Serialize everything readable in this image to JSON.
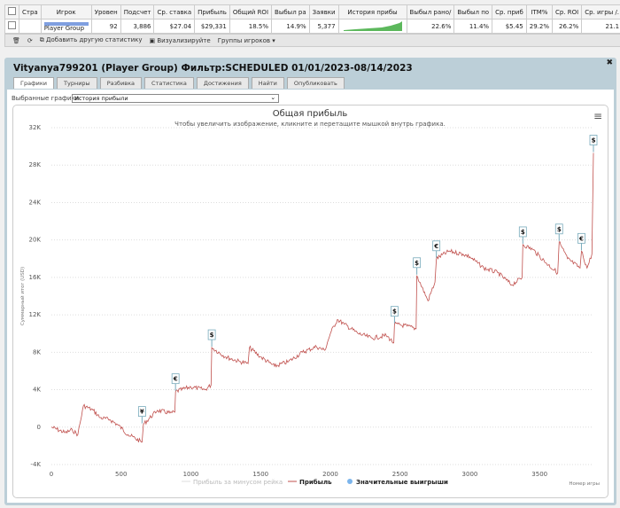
{
  "table": {
    "headers": [
      "Стра",
      "Игрок",
      "Уровен",
      "Подсчет",
      "Ср. ставка",
      "Прибыль",
      "Общий ROI",
      "Выбыл ра",
      "Заявки",
      "История прибы",
      "Выбыл рано/",
      "Выбыл по",
      "Ср. приб",
      "ITM%",
      "Ср. ROI",
      "Ср. игры /."
    ],
    "row": {
      "player": "Player Group",
      "level": "92",
      "count": "3,886",
      "avg_stake": "$27.04",
      "profit": "$29,331",
      "roi": "18.5%",
      "early": "14.9%",
      "entries": "5,377",
      "early2": "22.6%",
      "late": "11.4%",
      "avg_profit": "$5.45",
      "itm": "29.2%",
      "avg_roi": "26.2%",
      "avg_games": "21.1",
      "remove": "x"
    }
  },
  "toolbar": {
    "add_stat": "Добавить другую статистику",
    "visualize": "Визуализируйте",
    "groups": "Группы игроков ▾"
  },
  "panel": {
    "title": "Vityanya799201 (Player Group) Фильтр:SCHEDULED 01/01/2023-08/14/2023",
    "close": "✖",
    "tabs": [
      "Графики",
      "Турниры",
      "Разбивка",
      "Статистика",
      "Достижения",
      "Найти",
      "Опубликовать"
    ],
    "selected_label": "Выбранные графики:",
    "selected_value": "История прибыли"
  },
  "chart_data": {
    "type": "line",
    "title": "Общая прибыль",
    "subtitle": "Чтобы увеличить изображение, кликните и перетащите мышкой внутрь графика.",
    "ylabel": "Суммарный итог (USD)",
    "xlabel": "Номер игры",
    "ylim": [
      -4000,
      32000
    ],
    "xlim": [
      0,
      3886
    ],
    "yticks": [
      -4000,
      0,
      4000,
      8000,
      12000,
      16000,
      20000,
      24000,
      28000,
      32000
    ],
    "ytick_labels": [
      "-4K",
      "0",
      "4K",
      "8K",
      "12K",
      "16K",
      "20K",
      "24K",
      "28K",
      "32K"
    ],
    "xticks": [
      0,
      500,
      1000,
      1500,
      2000,
      2500,
      3000,
      3500
    ],
    "xtick_labels": [
      "0",
      "500",
      "1000",
      "1500",
      "2000",
      "2500",
      "3000",
      "3500"
    ],
    "legend": [
      "Прибыль за минусом рейка",
      "Прибыль",
      "Значительные выигрыши"
    ],
    "series": [
      {
        "name": "Прибыль",
        "color": "#c0504d",
        "points": [
          [
            0,
            0
          ],
          [
            100,
            -600
          ],
          [
            150,
            -300
          ],
          [
            190,
            -800
          ],
          [
            230,
            2300
          ],
          [
            300,
            1800
          ],
          [
            350,
            1000
          ],
          [
            420,
            800
          ],
          [
            480,
            200
          ],
          [
            550,
            -800
          ],
          [
            650,
            -1600
          ],
          [
            660,
            300
          ],
          [
            760,
            1800
          ],
          [
            850,
            1500
          ],
          [
            885,
            1600
          ],
          [
            890,
            3800
          ],
          [
            1000,
            4300
          ],
          [
            1100,
            4000
          ],
          [
            1145,
            4500
          ],
          [
            1150,
            8500
          ],
          [
            1250,
            7500
          ],
          [
            1350,
            7000
          ],
          [
            1410,
            6800
          ],
          [
            1420,
            8500
          ],
          [
            1500,
            7500
          ],
          [
            1600,
            6500
          ],
          [
            1700,
            7000
          ],
          [
            1800,
            8000
          ],
          [
            1900,
            8600
          ],
          [
            1960,
            8200
          ],
          [
            2000,
            10000
          ],
          [
            2050,
            11500
          ],
          [
            2100,
            11000
          ],
          [
            2200,
            10000
          ],
          [
            2300,
            9500
          ],
          [
            2400,
            9800
          ],
          [
            2455,
            9000
          ],
          [
            2460,
            11000
          ],
          [
            2550,
            10800
          ],
          [
            2615,
            10500
          ],
          [
            2620,
            16200
          ],
          [
            2700,
            13500
          ],
          [
            2750,
            15500
          ],
          [
            2760,
            18000
          ],
          [
            2850,
            18800
          ],
          [
            2950,
            18500
          ],
          [
            3000,
            18200
          ],
          [
            3100,
            17000
          ],
          [
            3200,
            16500
          ],
          [
            3300,
            15200
          ],
          [
            3375,
            16000
          ],
          [
            3380,
            19500
          ],
          [
            3450,
            19000
          ],
          [
            3550,
            17500
          ],
          [
            3630,
            16500
          ],
          [
            3640,
            19800
          ],
          [
            3700,
            18000
          ],
          [
            3790,
            17000
          ],
          [
            3800,
            18800
          ],
          [
            3840,
            17000
          ],
          [
            3875,
            18500
          ],
          [
            3886,
            29300
          ]
        ]
      }
    ],
    "big_wins": [
      {
        "x": 650,
        "y": 300,
        "symbol": "¥"
      },
      {
        "x": 890,
        "y": 3800,
        "symbol": "€"
      },
      {
        "x": 1150,
        "y": 8500,
        "symbol": "$"
      },
      {
        "x": 2460,
        "y": 11000,
        "symbol": "$"
      },
      {
        "x": 2620,
        "y": 16200,
        "symbol": "$"
      },
      {
        "x": 2760,
        "y": 18000,
        "symbol": "€"
      },
      {
        "x": 3380,
        "y": 19500,
        "symbol": "$"
      },
      {
        "x": 3640,
        "y": 19800,
        "symbol": "$"
      },
      {
        "x": 3800,
        "y": 18800,
        "symbol": "€"
      },
      {
        "x": 3886,
        "y": 29300,
        "symbol": "$"
      }
    ]
  }
}
